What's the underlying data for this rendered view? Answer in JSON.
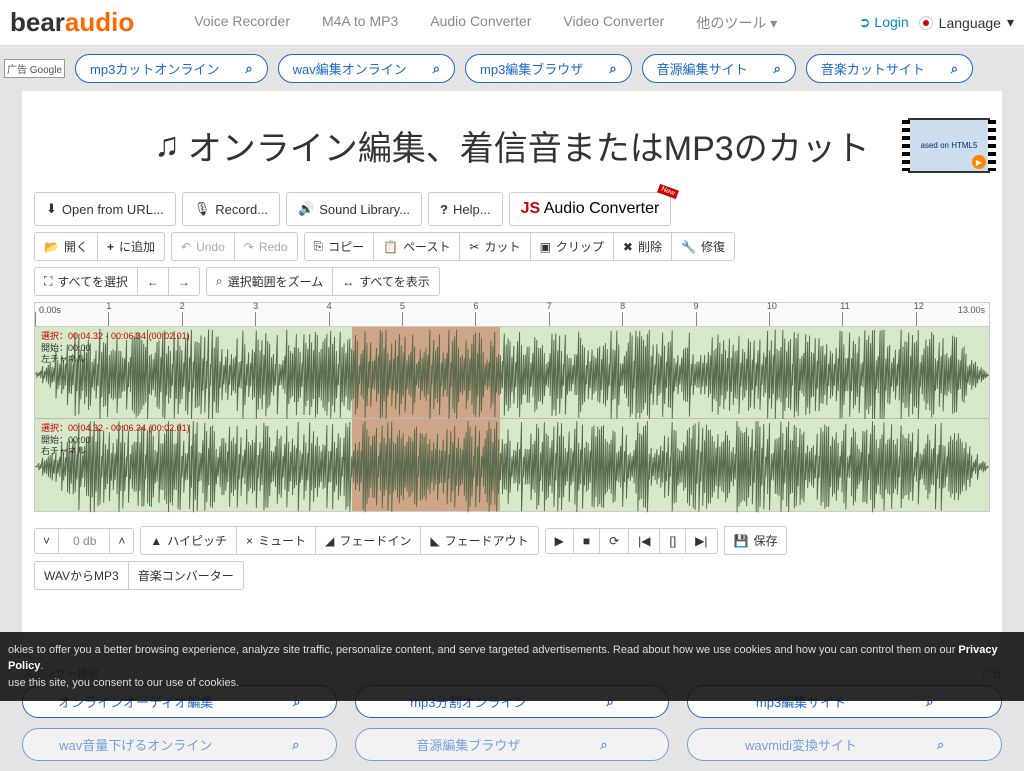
{
  "logo": {
    "part1": "bear",
    "part2": "audio"
  },
  "nav": [
    "Voice Recorder",
    "M4A to MP3",
    "Audio Converter",
    "Video Converter",
    "他のツール"
  ],
  "login": "Login",
  "language": "Language",
  "ad_label": "广告",
  "google": "Google",
  "top_pills": [
    "mp3カットオンライン",
    "wav編集オンライン",
    "mp3編集ブラウザ",
    "音源編集サイト",
    "音楽カットサイト"
  ],
  "title": "オンライン編集、着信音またはMP3のカット",
  "thumb_text": "ased on HTML5",
  "row1": {
    "open": "Open from URL...",
    "record": "Record...",
    "lib": "Sound Library...",
    "help": "Help..."
  },
  "jsconv": {
    "j": "JS",
    "rest": " Audio Converter",
    "badge": "New"
  },
  "row2": {
    "open": "開く",
    "add": "に追加",
    "undo": "Undo",
    "redo": "Redo",
    "copy": "コピー",
    "paste": "ペースト",
    "cut": "カット",
    "clip": "クリップ",
    "del": "削除",
    "restore": "修復"
  },
  "row3": {
    "selall": "すべてを選択",
    "zoom": "選択範囲をズーム",
    "showall": "すべてを表示"
  },
  "ruler": {
    "start": "0.00s",
    "end": "13.00s",
    "ticks": [
      "1",
      "2",
      "3",
      "4",
      "5",
      "6",
      "7",
      "8",
      "9",
      "10",
      "11",
      "12"
    ]
  },
  "ch": {
    "sel": "選択：00:04.32 - 00:06.34 (00:02.01)",
    "start": "開始：00:00",
    "left": "左チャネル",
    "right": "右チャネル"
  },
  "db_label": "0 db",
  "bottom_btns": {
    "hi": "ハイピッチ",
    "mute": "ミュート",
    "fadein": "フェードイン",
    "fadeout": "フェードアウト",
    "save": "保存",
    "wav": "WAVからMP3",
    "conv": "音楽コンバーター"
  },
  "sponsor": "スポンサー検索",
  "ad2": "广告",
  "pills2": [
    "オンラインオーディオ編集",
    "mp3分割オンライン",
    "mp3編集サイト"
  ],
  "pills3": [
    "wav音量下げるオンライン",
    "音源編集ブラウザ",
    "wavmidi変換サイト"
  ],
  "cookie": {
    "p1": "okies to offer you a better browsing experience, analyze site traffic, personalize content, and serve targeted advertisements. Read about how we use cookies and how you can control them on our ",
    "pp": "Privacy Policy",
    "p2": "use this site, you consent to our use of cookies."
  }
}
